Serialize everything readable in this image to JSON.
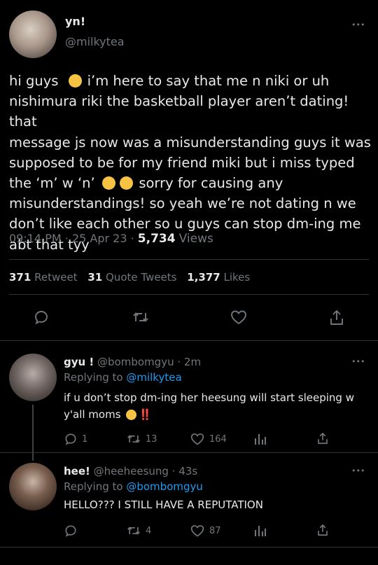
{
  "main_tweet": {
    "display_name": "yn!",
    "handle": "@milkytea",
    "text_lines": [
      "hi guys",
      "i’m here to say that me n niki or uh",
      "nishimura riki the basketball player aren’t dating! that",
      "message js now was a misunderstanding guys it was",
      "supposed to be for my friend miki but i miss typed",
      "the ‘m’ w ‘n’",
      "sorry for causing any",
      "misunderstandings! so yeah we’re not dating n we",
      "don’t like each other so u guys can stop dm-ing me",
      "abt that tyy"
    ],
    "time": "09:14 PM",
    "sep1": "·",
    "date": "25 Apr 23",
    "sep2": "·",
    "views_count": "5,734",
    "views_label": "Views",
    "retweets_count": "371",
    "retweets_label": "Retweet",
    "quotes_count": "31",
    "quotes_label": "Quote Tweets",
    "likes_count": "1,377",
    "likes_label": "Likes"
  },
  "reply1": {
    "display_name": "gyu !",
    "handle": "@bombomgyu",
    "dot": "·",
    "time": "2m",
    "replying_label": "Replying to",
    "replying_to": "@milkytea",
    "text_line1": "if u don’t stop dm-ing her heesung will start sleeping w",
    "text_line2": "y'all moms",
    "text_end": "‼️",
    "replies": "1",
    "retweets": "13",
    "likes": "164"
  },
  "reply2": {
    "display_name": "hee!",
    "handle": "@heeheesung",
    "dot": "·",
    "time": "43s",
    "replying_label": "Replying to",
    "replying_to": "@bombomgyu",
    "text": "HELLO??? I STILL HAVE A REPUTATION",
    "retweets": "4",
    "likes": "87"
  },
  "more_icon": "•••",
  "colors": {
    "background": "#000000",
    "text": "#e7e9ea",
    "muted": "#71767b",
    "link": "#1d9bf0",
    "divider": "#2f3336",
    "red": "#f4212e"
  }
}
